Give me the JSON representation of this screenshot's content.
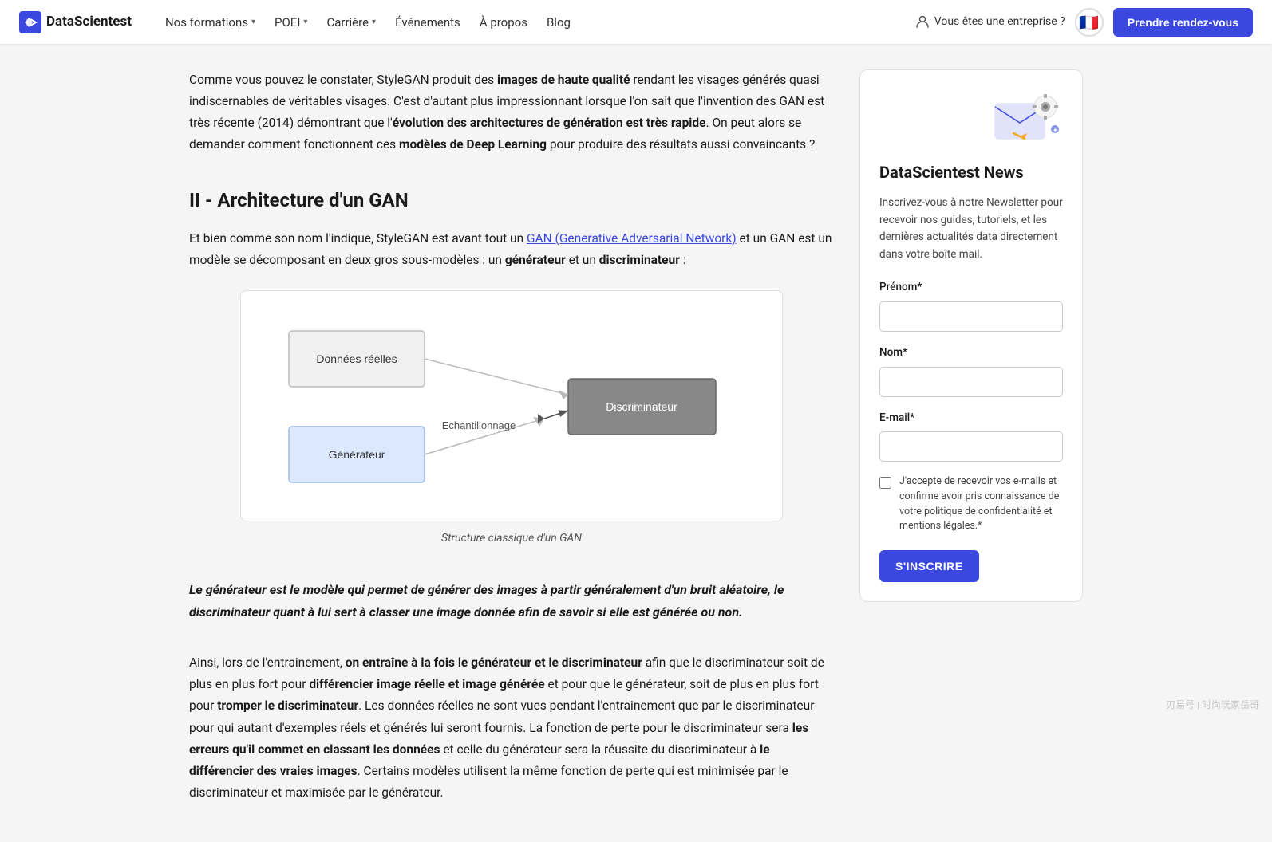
{
  "nav": {
    "logo_text": "DataScientest",
    "links": [
      {
        "label": "Nos formations",
        "has_chevron": true
      },
      {
        "label": "POEI",
        "has_chevron": true
      },
      {
        "label": "Carrière",
        "has_chevron": true
      },
      {
        "label": "Événements",
        "has_chevron": false
      },
      {
        "label": "À propos",
        "has_chevron": false
      },
      {
        "label": "Blog",
        "has_chevron": false
      }
    ],
    "enterprise_label": "Vous êtes une entreprise ?",
    "flag_emoji": "🇫🇷",
    "cta_label": "Prendre rendez-vous"
  },
  "article": {
    "intro_paragraph": "Comme vous pouvez le constater, StyleGAN produit des images de haute qualité rendant les visages générés quasi indiscernables de véritables visages. C'est d'autant plus impressionnant lorsque l'on sait que l'invention des GAN est très récente (2014) démontrant que l'évolution des architectures de génération est très rapide. On peut alors se demander comment fonctionnent ces modèles de Deep Learning pour produire des résultats aussi convaincants ?",
    "intro_bold_parts": [
      "images de haute qualité",
      "évolution des architectures de génération est très rapide",
      "modèles de Deep Learning"
    ],
    "section_title": "II - Architecture d'un GAN",
    "section_intro_plain": "Et bien comme son nom l'indique, StyleGAN est avant tout un ",
    "section_intro_link": "GAN (Generative Adversarial Network)",
    "section_intro_end": " et un GAN est un modèle se décomposant en deux gros sous-modèles : un ",
    "section_intro_bold1": "générateur",
    "section_intro_mid": " et un ",
    "section_intro_bold2": "discriminateur",
    "section_intro_colon": " :",
    "diagram": {
      "box1_label": "Données réelles",
      "box2_label": "Générateur",
      "box3_label": "Discriminateur",
      "arrow_label": "Echantillonnage",
      "caption": "Structure classique d'un GAN"
    },
    "highlight_text": "Le générateur est le modèle qui permet de générer des images à partir généralement d'un bruit aléatoire, le discriminateur quant à lui sert à classer une image donnée afin de savoir si elle est générée ou non.",
    "body_paragraph": "Ainsi, lors de l'entrainement, on entraîne à la fois le générateur et le discriminateur afin que le discriminateur soit de plus en plus fort pour différencier image réelle et image générée et pour que le générateur, soit de plus en plus fort pour tromper le discriminateur. Les données réelles ne sont vues pendant l'entrainement que par le discriminateur pour qui autant d'exemples réels et générés lui seront fournis. La fonction de perte pour le discriminateur sera les erreurs qu'il commet en classant les données et celle du générateur sera la réussite du discriminateur à le différencier des vraies images. Certains modèles utilisent la même fonction de perte qui est minimisée par le discriminateur et maximisée par le générateur."
  },
  "sidebar": {
    "title": "DataScientest News",
    "description": "Inscrivez-vous à notre Newsletter pour recevoir nos guides, tutoriels, et les dernières actualités data directement dans votre boîte mail.",
    "prenom_label": "Prénom*",
    "nom_label": "Nom*",
    "email_label": "E-mail*",
    "checkbox_text": "J'accepte de recevoir vos e-mails et confirme avoir pris connaissance de votre politique de confidentialité et mentions légales.*",
    "submit_label": "S'INSCRIRE"
  },
  "watermark": "刃易号 | 时尚玩家岳哥"
}
